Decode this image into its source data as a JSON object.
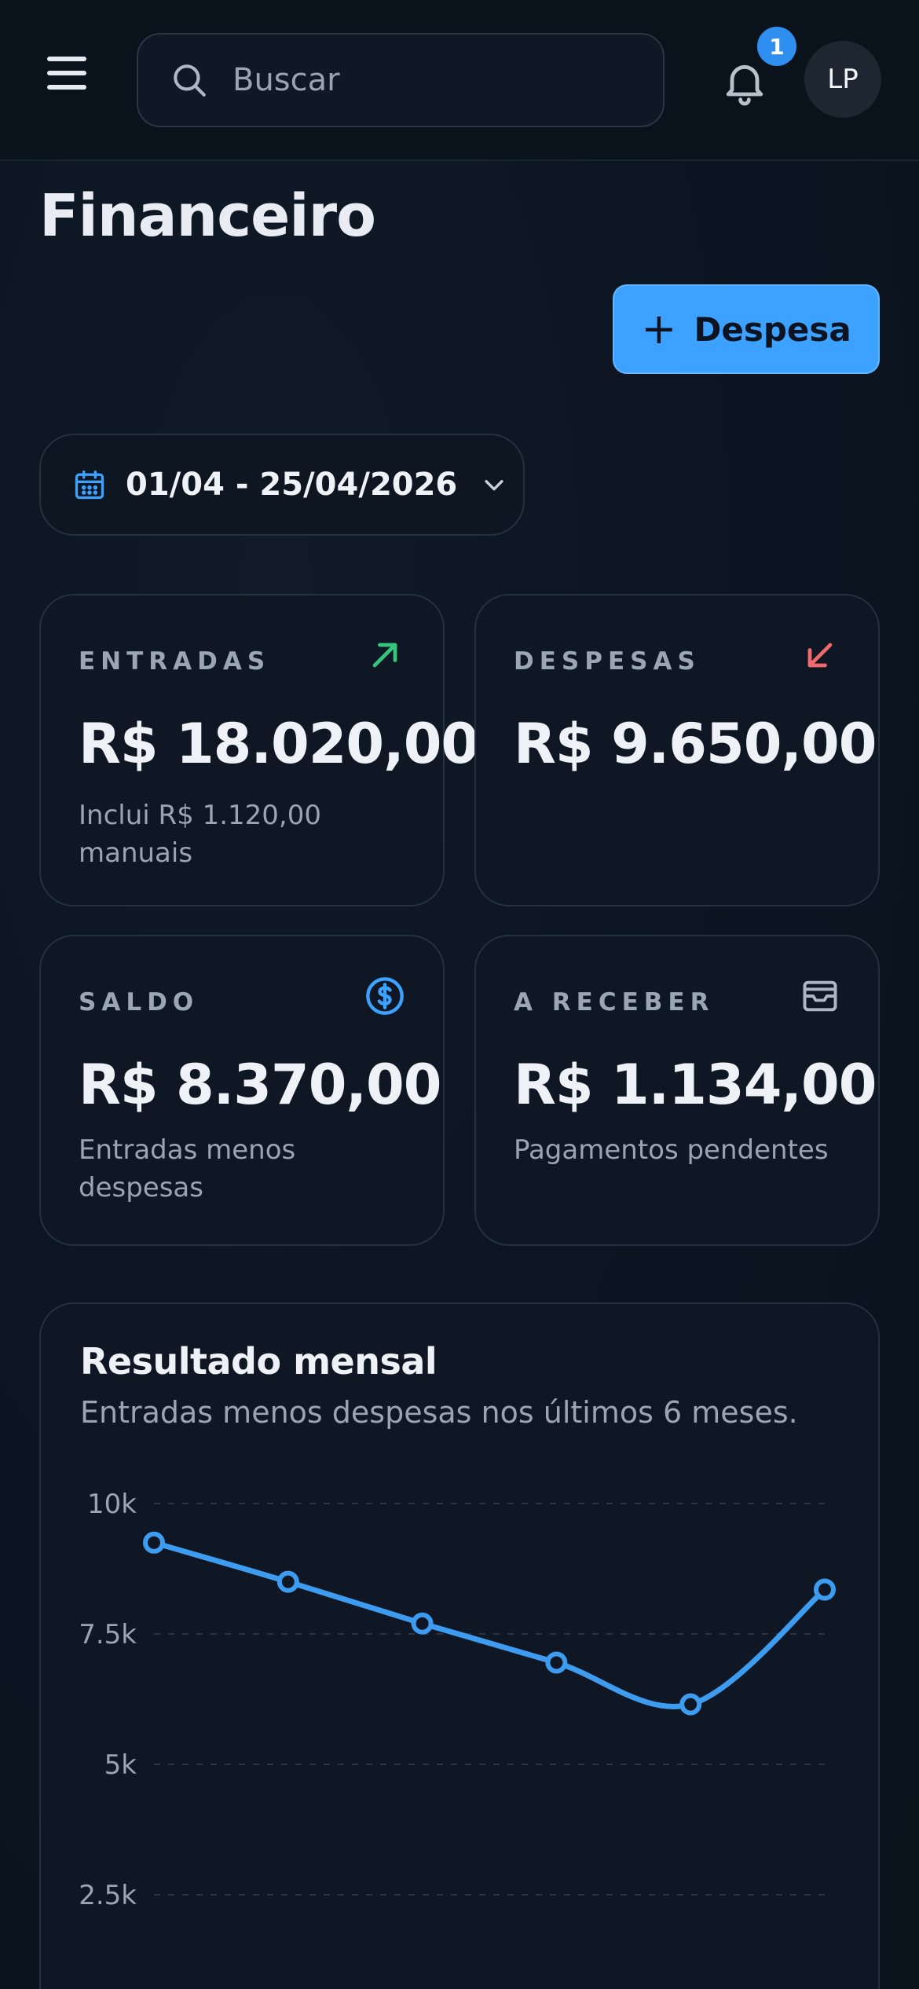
{
  "header": {
    "search_placeholder": "Buscar",
    "notification_count": "1",
    "avatar_initials": "LP"
  },
  "page": {
    "title": "Financeiro",
    "add_button_label": "Despesa",
    "date_range": "01/04 - 25/04/2026"
  },
  "cards": {
    "entradas": {
      "label": "ENTRADAS",
      "value": "R$ 18.020,00",
      "sub": "Inclui R$ 1.120,00 manuais",
      "icon": "arrow-up-right-icon",
      "color": "#34c77b"
    },
    "despesas": {
      "label": "DESPESAS",
      "value": "R$ 9.650,00",
      "sub": "",
      "icon": "arrow-down-left-icon",
      "color": "#f06b6b"
    },
    "saldo": {
      "label": "SALDO",
      "value": "R$ 8.370,00",
      "sub": "Entradas menos despesas",
      "icon": "dollar-circle-icon",
      "color": "#3da2ff"
    },
    "receber": {
      "label": "A RECEBER",
      "value": "R$ 1.134,00",
      "sub": "Pagamentos pendentes",
      "icon": "inbox-icon",
      "color": "#9aa4b2"
    }
  },
  "chart_card": {
    "title": "Resultado mensal",
    "subtitle": "Entradas menos despesas nos últimos 6 meses."
  },
  "chart_data": {
    "type": "line",
    "title": "Resultado mensal",
    "xlabel": "",
    "ylabel": "",
    "y_ticks": [
      "10k",
      "7.5k",
      "5k",
      "2.5k"
    ],
    "y_tick_values": [
      10000,
      7500,
      5000,
      2500
    ],
    "ylim": [
      0,
      10000
    ],
    "series": [
      {
        "values": [
          9250,
          8500,
          7700,
          6950,
          6150,
          8350
        ]
      }
    ],
    "grid": true,
    "line_color": "#3d9cf0"
  },
  "colors": {
    "accent": "#3da2ff",
    "background": "#0b1420",
    "card": "#0e1723"
  }
}
